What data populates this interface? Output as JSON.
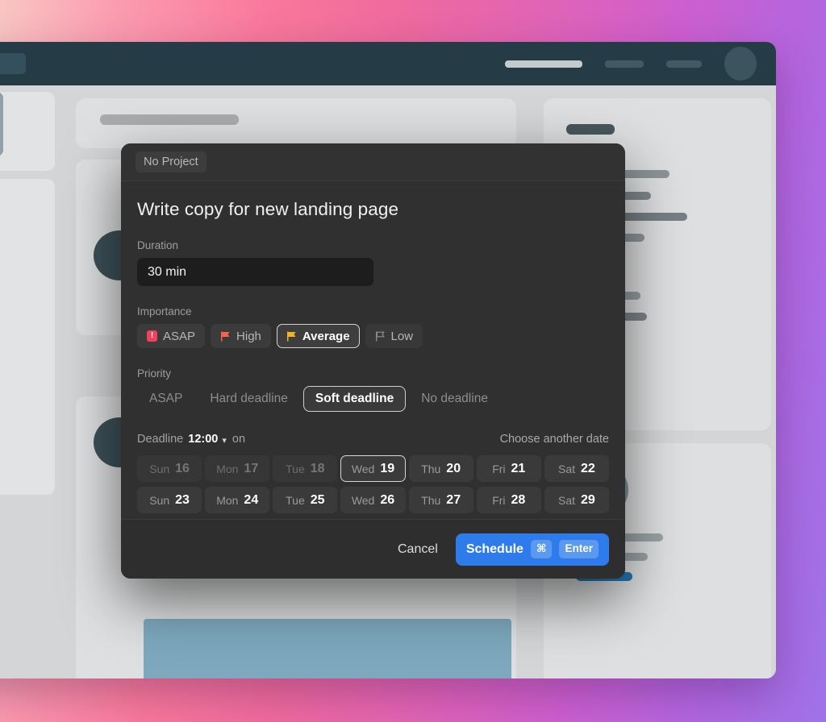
{
  "background": {
    "gradient_start": "#f9c6c4",
    "gradient_mid": "#e063b7",
    "gradient_end": "#9f72e8"
  },
  "app_window": {
    "header": {
      "accent_color": "#253c46",
      "left_chip": "nav-chip",
      "right_items": [
        "bar-light",
        "bar-dark",
        "bar-dark",
        "avatar"
      ]
    },
    "accent_blue": "#2176b7",
    "card_color": "#dedfe0",
    "tile_color": "#8fa0a8"
  },
  "modal": {
    "project_chip": "No Project",
    "task_title": "Write copy for new landing page",
    "duration": {
      "label": "Duration",
      "value": "30 min",
      "placeholder": "Duration"
    },
    "importance": {
      "label": "Importance",
      "options": [
        {
          "label": "ASAP",
          "icon": "alert-box-icon",
          "color": "#f2415a",
          "selected": false
        },
        {
          "label": "High",
          "icon": "flag-icon",
          "color": "#f2654f",
          "selected": false
        },
        {
          "label": "Average",
          "icon": "flag-icon",
          "color": "#f0b429",
          "selected": true
        },
        {
          "label": "Low",
          "icon": "flag-outline-icon",
          "color": "#8d8d8d",
          "selected": false
        }
      ]
    },
    "priority": {
      "label": "Priority",
      "options": [
        {
          "label": "ASAP",
          "selected": false
        },
        {
          "label": "Hard deadline",
          "selected": false
        },
        {
          "label": "Soft deadline",
          "selected": true
        },
        {
          "label": "No deadline",
          "selected": false
        }
      ]
    },
    "deadline": {
      "prefix": "Deadline",
      "time": "12:00",
      "suffix": "on",
      "choose_another": "Choose another date"
    },
    "dates": {
      "row1": [
        {
          "dow": "Sun",
          "num": "16",
          "state": "past"
        },
        {
          "dow": "Mon",
          "num": "17",
          "state": "past"
        },
        {
          "dow": "Tue",
          "num": "18",
          "state": "past"
        },
        {
          "dow": "Wed",
          "num": "19",
          "state": "selected"
        },
        {
          "dow": "Thu",
          "num": "20",
          "state": "normal"
        },
        {
          "dow": "Fri",
          "num": "21",
          "state": "normal"
        },
        {
          "dow": "Sat",
          "num": "22",
          "state": "normal"
        }
      ],
      "row2": [
        {
          "dow": "Sun",
          "num": "23",
          "state": "normal"
        },
        {
          "dow": "Mon",
          "num": "24",
          "state": "normal"
        },
        {
          "dow": "Tue",
          "num": "25",
          "state": "normal"
        },
        {
          "dow": "Wed",
          "num": "26",
          "state": "normal"
        },
        {
          "dow": "Thu",
          "num": "27",
          "state": "normal"
        },
        {
          "dow": "Fri",
          "num": "28",
          "state": "normal"
        },
        {
          "dow": "Sat",
          "num": "29",
          "state": "normal"
        }
      ]
    },
    "footer": {
      "cancel": "Cancel",
      "schedule": "Schedule",
      "key_cmd": "⌘",
      "key_enter": "Enter",
      "button_color": "#2e7cec"
    }
  }
}
